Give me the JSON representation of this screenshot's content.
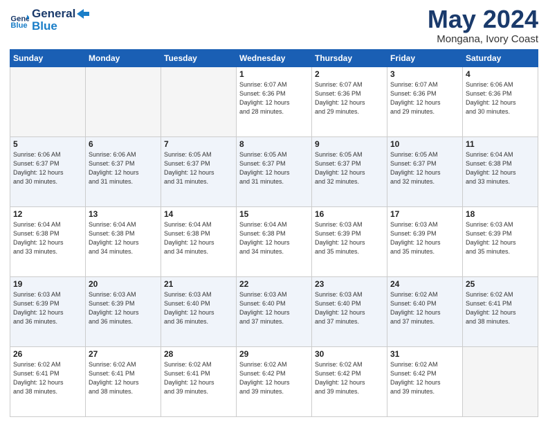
{
  "header": {
    "logo_line1": "General",
    "logo_line2": "Blue",
    "month": "May 2024",
    "location": "Mongana, Ivory Coast"
  },
  "weekdays": [
    "Sunday",
    "Monday",
    "Tuesday",
    "Wednesday",
    "Thursday",
    "Friday",
    "Saturday"
  ],
  "weeks": [
    [
      {
        "day": "",
        "sunrise": "",
        "sunset": "",
        "daylight": ""
      },
      {
        "day": "",
        "sunrise": "",
        "sunset": "",
        "daylight": ""
      },
      {
        "day": "",
        "sunrise": "",
        "sunset": "",
        "daylight": ""
      },
      {
        "day": "1",
        "sunrise": "Sunrise: 6:07 AM",
        "sunset": "Sunset: 6:36 PM",
        "daylight": "Daylight: 12 hours and 28 minutes."
      },
      {
        "day": "2",
        "sunrise": "Sunrise: 6:07 AM",
        "sunset": "Sunset: 6:36 PM",
        "daylight": "Daylight: 12 hours and 29 minutes."
      },
      {
        "day": "3",
        "sunrise": "Sunrise: 6:07 AM",
        "sunset": "Sunset: 6:36 PM",
        "daylight": "Daylight: 12 hours and 29 minutes."
      },
      {
        "day": "4",
        "sunrise": "Sunrise: 6:06 AM",
        "sunset": "Sunset: 6:36 PM",
        "daylight": "Daylight: 12 hours and 30 minutes."
      }
    ],
    [
      {
        "day": "5",
        "sunrise": "Sunrise: 6:06 AM",
        "sunset": "Sunset: 6:37 PM",
        "daylight": "Daylight: 12 hours and 30 minutes."
      },
      {
        "day": "6",
        "sunrise": "Sunrise: 6:06 AM",
        "sunset": "Sunset: 6:37 PM",
        "daylight": "Daylight: 12 hours and 31 minutes."
      },
      {
        "day": "7",
        "sunrise": "Sunrise: 6:05 AM",
        "sunset": "Sunset: 6:37 PM",
        "daylight": "Daylight: 12 hours and 31 minutes."
      },
      {
        "day": "8",
        "sunrise": "Sunrise: 6:05 AM",
        "sunset": "Sunset: 6:37 PM",
        "daylight": "Daylight: 12 hours and 31 minutes."
      },
      {
        "day": "9",
        "sunrise": "Sunrise: 6:05 AM",
        "sunset": "Sunset: 6:37 PM",
        "daylight": "Daylight: 12 hours and 32 minutes."
      },
      {
        "day": "10",
        "sunrise": "Sunrise: 6:05 AM",
        "sunset": "Sunset: 6:37 PM",
        "daylight": "Daylight: 12 hours and 32 minutes."
      },
      {
        "day": "11",
        "sunrise": "Sunrise: 6:04 AM",
        "sunset": "Sunset: 6:38 PM",
        "daylight": "Daylight: 12 hours and 33 minutes."
      }
    ],
    [
      {
        "day": "12",
        "sunrise": "Sunrise: 6:04 AM",
        "sunset": "Sunset: 6:38 PM",
        "daylight": "Daylight: 12 hours and 33 minutes."
      },
      {
        "day": "13",
        "sunrise": "Sunrise: 6:04 AM",
        "sunset": "Sunset: 6:38 PM",
        "daylight": "Daylight: 12 hours and 34 minutes."
      },
      {
        "day": "14",
        "sunrise": "Sunrise: 6:04 AM",
        "sunset": "Sunset: 6:38 PM",
        "daylight": "Daylight: 12 hours and 34 minutes."
      },
      {
        "day": "15",
        "sunrise": "Sunrise: 6:04 AM",
        "sunset": "Sunset: 6:38 PM",
        "daylight": "Daylight: 12 hours and 34 minutes."
      },
      {
        "day": "16",
        "sunrise": "Sunrise: 6:03 AM",
        "sunset": "Sunset: 6:39 PM",
        "daylight": "Daylight: 12 hours and 35 minutes."
      },
      {
        "day": "17",
        "sunrise": "Sunrise: 6:03 AM",
        "sunset": "Sunset: 6:39 PM",
        "daylight": "Daylight: 12 hours and 35 minutes."
      },
      {
        "day": "18",
        "sunrise": "Sunrise: 6:03 AM",
        "sunset": "Sunset: 6:39 PM",
        "daylight": "Daylight: 12 hours and 35 minutes."
      }
    ],
    [
      {
        "day": "19",
        "sunrise": "Sunrise: 6:03 AM",
        "sunset": "Sunset: 6:39 PM",
        "daylight": "Daylight: 12 hours and 36 minutes."
      },
      {
        "day": "20",
        "sunrise": "Sunrise: 6:03 AM",
        "sunset": "Sunset: 6:39 PM",
        "daylight": "Daylight: 12 hours and 36 minutes."
      },
      {
        "day": "21",
        "sunrise": "Sunrise: 6:03 AM",
        "sunset": "Sunset: 6:40 PM",
        "daylight": "Daylight: 12 hours and 36 minutes."
      },
      {
        "day": "22",
        "sunrise": "Sunrise: 6:03 AM",
        "sunset": "Sunset: 6:40 PM",
        "daylight": "Daylight: 12 hours and 37 minutes."
      },
      {
        "day": "23",
        "sunrise": "Sunrise: 6:03 AM",
        "sunset": "Sunset: 6:40 PM",
        "daylight": "Daylight: 12 hours and 37 minutes."
      },
      {
        "day": "24",
        "sunrise": "Sunrise: 6:02 AM",
        "sunset": "Sunset: 6:40 PM",
        "daylight": "Daylight: 12 hours and 37 minutes."
      },
      {
        "day": "25",
        "sunrise": "Sunrise: 6:02 AM",
        "sunset": "Sunset: 6:41 PM",
        "daylight": "Daylight: 12 hours and 38 minutes."
      }
    ],
    [
      {
        "day": "26",
        "sunrise": "Sunrise: 6:02 AM",
        "sunset": "Sunset: 6:41 PM",
        "daylight": "Daylight: 12 hours and 38 minutes."
      },
      {
        "day": "27",
        "sunrise": "Sunrise: 6:02 AM",
        "sunset": "Sunset: 6:41 PM",
        "daylight": "Daylight: 12 hours and 38 minutes."
      },
      {
        "day": "28",
        "sunrise": "Sunrise: 6:02 AM",
        "sunset": "Sunset: 6:41 PM",
        "daylight": "Daylight: 12 hours and 39 minutes."
      },
      {
        "day": "29",
        "sunrise": "Sunrise: 6:02 AM",
        "sunset": "Sunset: 6:42 PM",
        "daylight": "Daylight: 12 hours and 39 minutes."
      },
      {
        "day": "30",
        "sunrise": "Sunrise: 6:02 AM",
        "sunset": "Sunset: 6:42 PM",
        "daylight": "Daylight: 12 hours and 39 minutes."
      },
      {
        "day": "31",
        "sunrise": "Sunrise: 6:02 AM",
        "sunset": "Sunset: 6:42 PM",
        "daylight": "Daylight: 12 hours and 39 minutes."
      },
      {
        "day": "",
        "sunrise": "",
        "sunset": "",
        "daylight": ""
      }
    ]
  ]
}
